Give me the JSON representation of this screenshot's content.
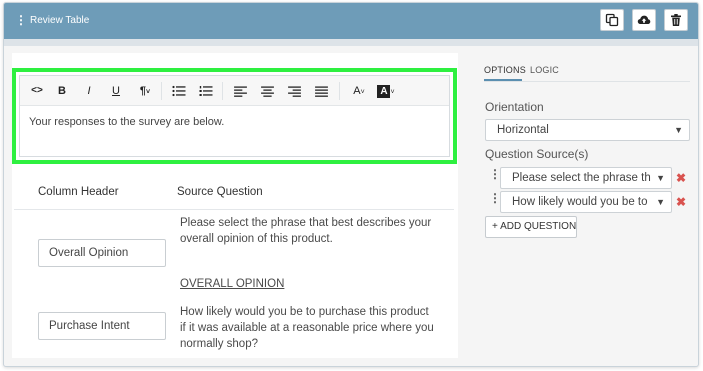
{
  "header": {
    "title": "Review Table",
    "buttons": [
      "copy-icon",
      "cloud-upload-icon",
      "trash-icon"
    ]
  },
  "editor": {
    "toolbar": {
      "source": "<>",
      "bold": "B",
      "italic": "I",
      "underline": "U",
      "paragraph": "¶",
      "font_color": "A",
      "bg_color": "A"
    },
    "content": "Your responses to the survey are below."
  },
  "table": {
    "headers": {
      "column": "Column Header",
      "source": "Source Question"
    },
    "rows": [
      {
        "column_value": "Overall Opinion",
        "source": "Please select the phrase that best describes your overall opinion of this product."
      },
      {
        "column_value": "Purchase Intent",
        "link": "OVERALL OPINION",
        "source": "How likely would you be to purchase this product if it was available at a reasonable price where you normally shop?"
      }
    ]
  },
  "sidebar": {
    "tabs": [
      {
        "label": "OPTIONS",
        "active": true
      },
      {
        "label": "LOGIC",
        "active": false
      }
    ],
    "orientation": {
      "label": "Orientation",
      "value": "Horizontal"
    },
    "question_sources": {
      "label": "Question Source(s)",
      "items": [
        "Please select the phrase th",
        "How likely would you be to"
      ]
    },
    "add_button": "+ ADD QUESTION"
  },
  "colors": {
    "header": "#6e9cb8",
    "highlight": "#2ef040",
    "delete": "#d9534f"
  }
}
